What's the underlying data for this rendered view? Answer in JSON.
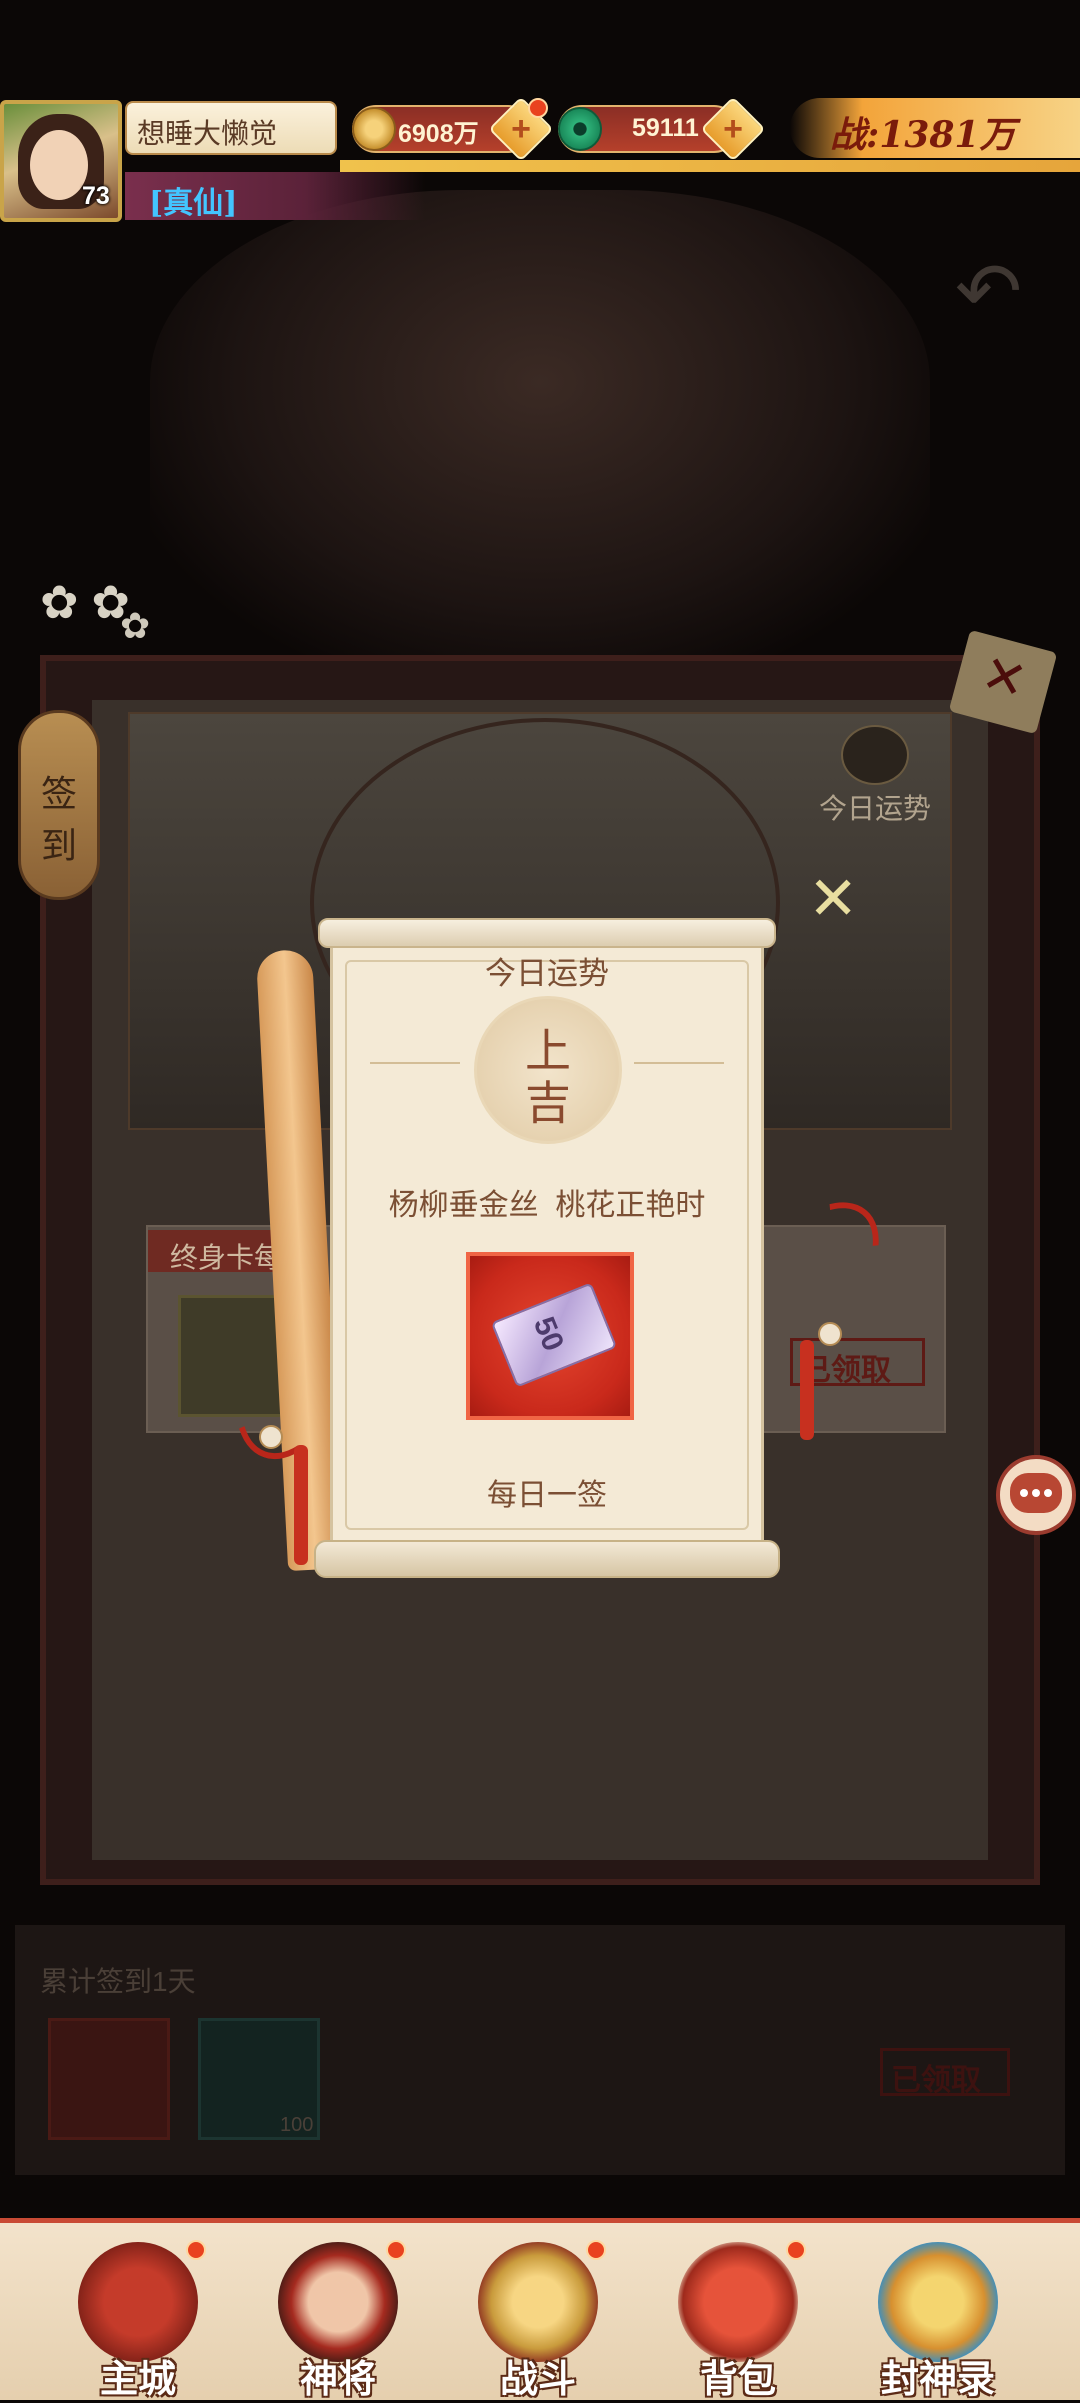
{
  "player": {
    "name": "想睡大懒觉",
    "level": "73",
    "title": "[真仙]",
    "copper": "6908万",
    "jade": "59111",
    "power": "战:1381万"
  },
  "signin_tab": {
    "char1": "签",
    "char2": "到"
  },
  "fortune_button": {
    "label": "今日运势"
  },
  "lifetime_card": {
    "label": "终身卡每",
    "claimed": "已领取"
  },
  "cumulative": {
    "label": "累计签到1天",
    "item_count": "100",
    "claimed": "已领取"
  },
  "popup": {
    "title": "今日运势",
    "fortune_top": "上",
    "fortune_bottom": "吉",
    "poem": "杨柳垂金丝  桃花正艳时",
    "reward_value": "50",
    "footer": "每日一签"
  },
  "nav": [
    {
      "label": "主城",
      "icon": "city-gate-icon"
    },
    {
      "label": "神将",
      "icon": "general-icon"
    },
    {
      "label": "战斗",
      "icon": "crossed-swords-icon"
    },
    {
      "label": "背包",
      "icon": "bag-icon"
    },
    {
      "label": "封神录",
      "icon": "scroll-record-icon"
    }
  ],
  "colors": {
    "accent_red": "#c9291b",
    "parchment": "#f4ead6",
    "gold": "#e6a53b",
    "title_blue": "#43c5ff"
  }
}
